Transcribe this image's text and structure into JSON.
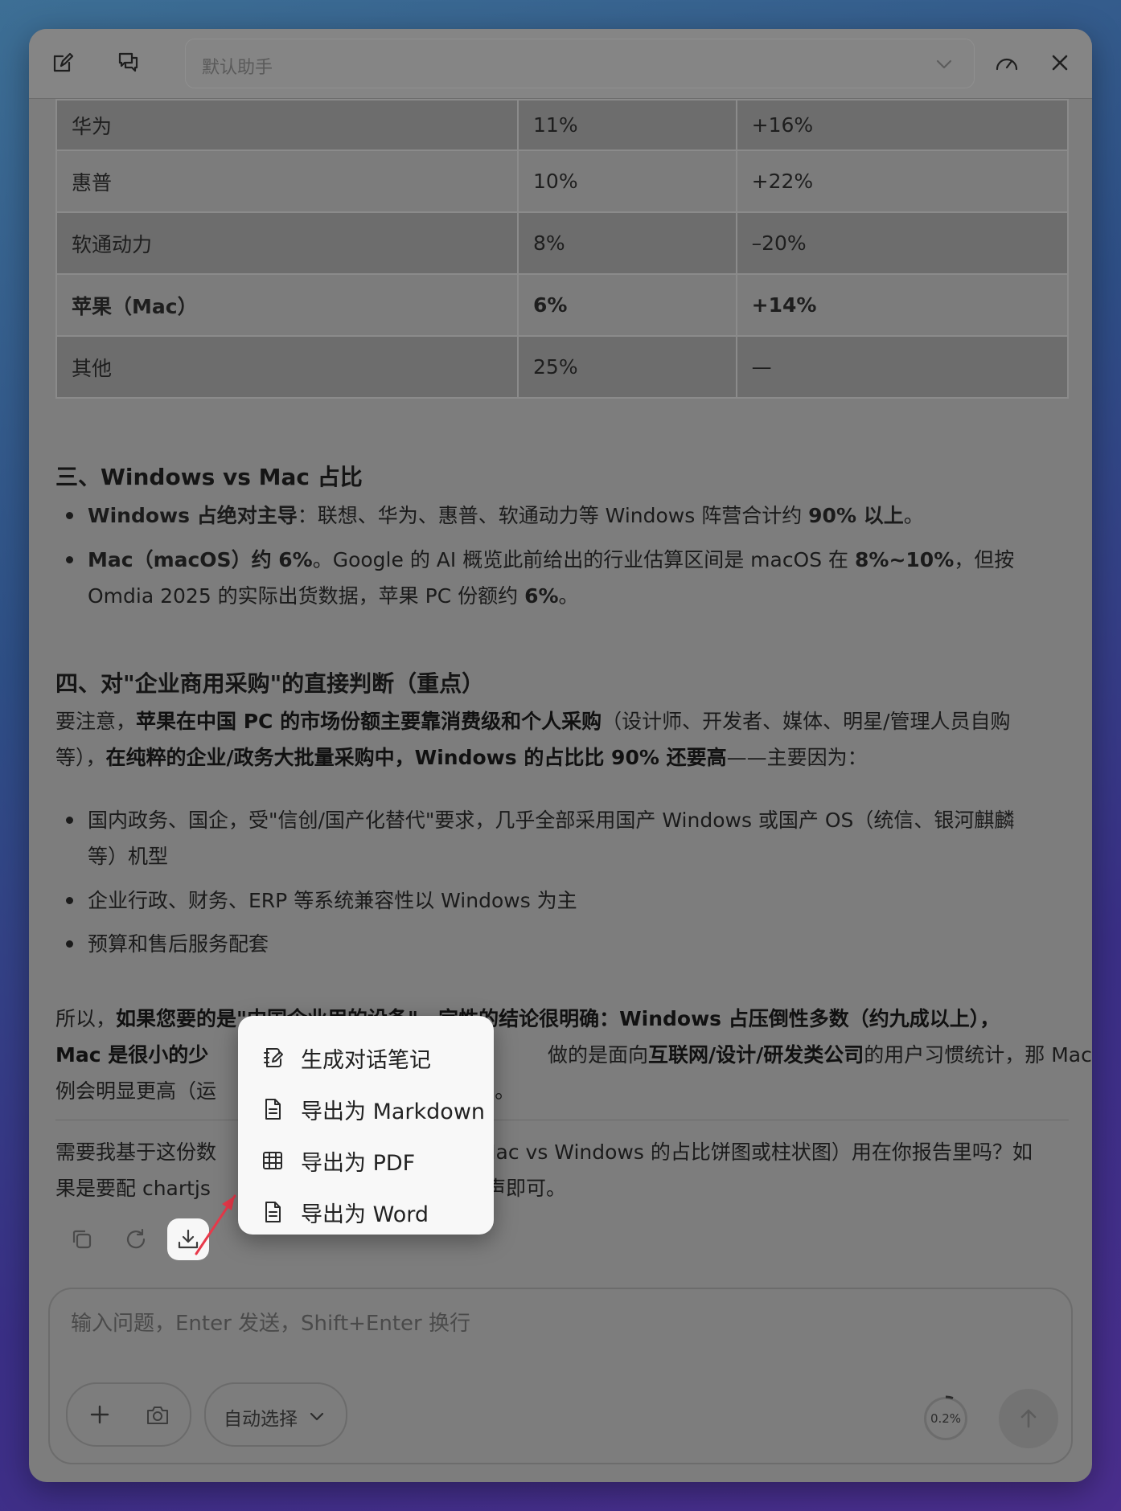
{
  "header": {
    "assistant_name": "默认助手",
    "icons": [
      "edit-icon",
      "chats-icon",
      "chevron-down-icon",
      "speedometer-icon",
      "close-icon"
    ]
  },
  "table": {
    "rows": [
      {
        "brand": "华为",
        "share": "11%",
        "growth": "+16%",
        "bold": false
      },
      {
        "brand": "惠普",
        "share": "10%",
        "growth": "+22%",
        "bold": false
      },
      {
        "brand": "软通动力",
        "share": "8%",
        "growth": "–20%",
        "bold": false
      },
      {
        "brand": "苹果（Mac）",
        "share": "6%",
        "growth": "+14%",
        "bold": true
      },
      {
        "brand": "其他",
        "share": "25%",
        "growth": "—",
        "bold": false
      }
    ]
  },
  "section3": {
    "heading": "三、Windows vs Mac 占比",
    "b1_bold": "Windows 占绝对主导",
    "b1_text": "：联想、华为、惠普、软通动力等 Windows 阵营合计约 ",
    "b1_bold2": "90% 以上",
    "b1_end": "。",
    "b2_bold": "Mac（macOS）约 6%",
    "b2_text": "。Google 的 AI 概览此前给出的行业估算区间是 macOS 在 ",
    "b2_bold2": "8%~10%",
    "b2_text2": "，但按",
    "b2_line2": "Omdia 2025 的实际出货数据，苹果 PC 份额约 ",
    "b2_bold3": "6%",
    "b2_end": "。"
  },
  "section4": {
    "heading": "四、对\"企业商用采购\"的直接判断（重点）",
    "p1_a": "要注意，",
    "p1_b": "苹果在中国 PC 的市场份额主要靠消费级和个人采购",
    "p1_c": "（设计师、开发者、媒体、明星/管理人员自购",
    "p1_d": "等），",
    "p1_e": "在纯粹的企业/政务大批量采购中，Windows 的占比比 90% 还要高",
    "p1_f": "——主要因为：",
    "li1_line1": "国内政务、国企，受\"信创/国产化替代\"要求，几乎全部采用国产 Windows 或国产 OS（统信、银河麒麟",
    "li1_line2": "等）机型",
    "li2": "企业行政、财务、ERP 等系统兼容性以 Windows 为主",
    "li3": "预算和售后服务配套",
    "c1_a": "所以，",
    "c1_b": "如果您要的是\"中国企业用的设备\"，定性的结论很明确：Windows 占压倒性多数（约九成以上），",
    "c2_a": "Mac 是很小的少",
    "c2_b": "做的是面向",
    "c2_c": "互联网/设计/研发类公司",
    "c2_d": "的用户习惯统计，那 Mac 比",
    "c3_a": "例会明显更高（运",
    "c3_b": "%）。",
    "q1_a": "需要我基于这份数",
    "q1_b": "如 Mac vs Windows 的占比饼图或柱状图）用在你报告里吗？如",
    "q2_a": "果是要配 chartjs",
    "q2_b": "我一声即可。"
  },
  "actions": {
    "icons": [
      "copy-icon",
      "regenerate-icon",
      "download-icon"
    ]
  },
  "export_menu": {
    "items": [
      {
        "label": "生成对话笔记",
        "icon": "note-edit-icon"
      },
      {
        "label": "导出为 Markdown",
        "icon": "file-icon"
      },
      {
        "label": "导出为 PDF",
        "icon": "table-icon"
      },
      {
        "label": "导出为 Word",
        "icon": "file-icon"
      }
    ]
  },
  "composer": {
    "placeholder": "输入问题，Enter 发送，Shift+Enter 换行",
    "model_label": "自动选择",
    "usage": "0.2%",
    "icons": [
      "plus-icon",
      "camera-icon",
      "chevron-down-icon",
      "send-arrow-icon"
    ]
  },
  "colors": {
    "dim_overlay": "#7d7d7d",
    "menu_bg": "#f8f8f8",
    "arrow": "#e8394a"
  }
}
